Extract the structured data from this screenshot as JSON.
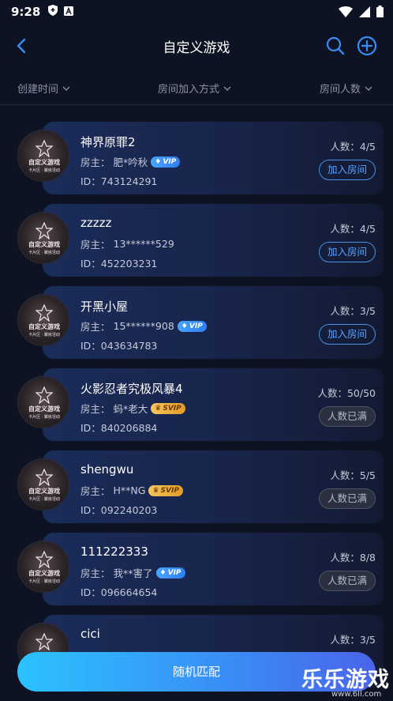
{
  "status_bar": {
    "time": "9:28"
  },
  "header": {
    "title": "自定义游戏"
  },
  "filters": [
    {
      "label": "创建时间"
    },
    {
      "label": "房间加入方式"
    },
    {
      "label": "房间人数"
    }
  ],
  "rooms": [
    {
      "name": "神界原罪2",
      "owner_prefix": "房主：",
      "owner": "肥*吟秋",
      "badge": "VIP",
      "badge_type": "vip",
      "id": "ID：743124291",
      "count": "人数：4/5",
      "action": "加入房间",
      "action_type": "join"
    },
    {
      "name": "zzzzz",
      "owner_prefix": "房主：",
      "owner": "13******529",
      "badge": "",
      "badge_type": "",
      "id": "ID：452203231",
      "count": "人数：4/5",
      "action": "加入房间",
      "action_type": "join"
    },
    {
      "name": "开黑小屋",
      "owner_prefix": "房主：",
      "owner": "15******908",
      "badge": "VIP",
      "badge_type": "vip",
      "id": "ID：043634783",
      "count": "人数：3/5",
      "action": "加入房间",
      "action_type": "join"
    },
    {
      "name": "火影忍者究极风暴4",
      "owner_prefix": "房主：",
      "owner": "蚂*老大",
      "badge": "SVIP",
      "badge_type": "svip",
      "id": "ID：840206884",
      "count": "人数：50/50",
      "action": "人数已满",
      "action_type": "full"
    },
    {
      "name": "shengwu",
      "owner_prefix": "房主：",
      "owner": "H**NG",
      "badge": "SVIP",
      "badge_type": "svip",
      "id": "ID：092240203",
      "count": "人数：5/5",
      "action": "人数已满",
      "action_type": "full"
    },
    {
      "name": "111222333",
      "owner_prefix": "房主：",
      "owner": "我**害了",
      "badge": "VIP",
      "badge_type": "vip",
      "id": "ID：096664654",
      "count": "人数：8/8",
      "action": "人数已满",
      "action_type": "full"
    },
    {
      "name": "cici",
      "owner_prefix": "",
      "owner": "",
      "badge": "",
      "badge_type": "",
      "id": "",
      "count": "人数：3/5",
      "action": "",
      "action_type": ""
    }
  ],
  "avatar_text": {
    "line1": "自定义游戏",
    "line2": "卡片区 · 聚房活动"
  },
  "match_button": {
    "label": "随机匹配"
  },
  "watermark": {
    "main": "乐乐游戏",
    "url": "www.6ll.com"
  },
  "colors": {
    "accent": "#3a8cf5",
    "background": "#0d1322",
    "vip": "#2d7df0",
    "svip": "#e49a27"
  }
}
